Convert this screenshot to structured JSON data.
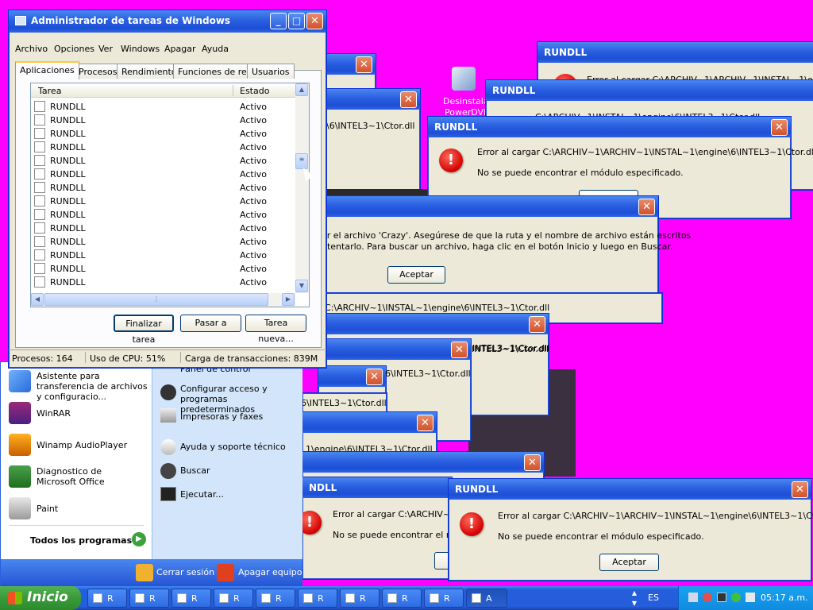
{
  "desktop": {
    "icon_label_1": "Desinstalar",
    "icon_label_2": "PowerDVD"
  },
  "dialogs": {
    "title": "RUNDLL",
    "close_glyph": "✕",
    "error_glyph": "!",
    "error_line_full": "Error al cargar C:\\ARCHIV~1\\ARCHIV~1\\INSTAL~1\\engine\\6\\INTEL3~1\\Ctor.dll",
    "error_line_cut": "Error al cargar C:\\ARCHIV~1\\ARCHIV~1\\INSTAL~1\\engine",
    "error_line_mid": "C:\\ARCHIV~1\\INSTAL~1\\engine\\6\\INTEL3~1\\Ctor.dll",
    "path_tail_a": "\\6\\INTEL3~1\\Ctor.dll",
    "path_tail_b": "INTEL3~1\\Ctor.dll",
    "path_tail_c": "6\\INTEL3~1\\Ctor.dll",
    "path_tail_d": "6\\INTEL3~1\\Ctor.dll",
    "path_tail_e": "1\\engine\\6\\INTEL3~1\\Ctor.dll",
    "module_line": "No se puede encontrar el módulo especificado.",
    "module_line_cut": "No se puede encontrar el módulo",
    "crazy_line_1": "ar el archivo 'Crazy'. Asegúrese de que la ruta y el nombre de archivo están escritos",
    "crazy_line_2": "ntentarlo. Para buscar un archivo, haga clic en el botón Inicio y luego en Buscar.",
    "ok_label": "Aceptar",
    "ndll_fragment": "NDLL"
  },
  "taskmgr": {
    "title": "Administrador de tareas de Windows",
    "menu": [
      "Archivo",
      "Opciones",
      "Ver",
      "Windows",
      "Apagar",
      "Ayuda"
    ],
    "tabs": [
      "Aplicaciones",
      "Procesos",
      "Rendimiento",
      "Funciones de red",
      "Usuarios"
    ],
    "columns": {
      "task": "Tarea",
      "status": "Estado"
    },
    "rows": [
      {
        "name": "RUNDLL",
        "status": "Activo"
      },
      {
        "name": "RUNDLL",
        "status": "Activo"
      },
      {
        "name": "RUNDLL",
        "status": "Activo"
      },
      {
        "name": "RUNDLL",
        "status": "Activo"
      },
      {
        "name": "RUNDLL",
        "status": "Activo"
      },
      {
        "name": "RUNDLL",
        "status": "Activo"
      },
      {
        "name": "RUNDLL",
        "status": "Activo"
      },
      {
        "name": "RUNDLL",
        "status": "Activo"
      },
      {
        "name": "RUNDLL",
        "status": "Activo"
      },
      {
        "name": "RUNDLL",
        "status": "Activo"
      },
      {
        "name": "RUNDLL",
        "status": "Activo"
      },
      {
        "name": "RUNDLL",
        "status": "Activo"
      },
      {
        "name": "RUNDLL",
        "status": "Activo"
      },
      {
        "name": "RUNDLL",
        "status": "Activo"
      }
    ],
    "buttons": {
      "end": "Finalizar tarea",
      "switch": "Pasar a",
      "new": "Tarea nueva..."
    },
    "status": {
      "processes": "Procesos: 164",
      "cpu": "Uso de CPU: 51%",
      "commit": "Carga de transacciones: 839M"
    }
  },
  "startmenu": {
    "left_items": [
      {
        "label": "Asistente para transferencia de archivos y configuracio..."
      },
      {
        "label": "WinRAR"
      },
      {
        "label": "Winamp AudioPlayer"
      },
      {
        "label": "Diagnostico de Microsoft Office"
      },
      {
        "label": "Paint"
      }
    ],
    "all_programs": "Todos los programas",
    "right_items": [
      {
        "label": "Panel de control"
      },
      {
        "label": "Configurar acceso y programas predeterminados"
      },
      {
        "label": "Impresoras y faxes"
      },
      {
        "label": "Ayuda y soporte técnico"
      },
      {
        "label": "Buscar"
      },
      {
        "label": "Ejecutar..."
      }
    ],
    "logoff": "Cerrar sesión",
    "shutdown": "Apagar equipo"
  },
  "taskbar": {
    "start_label": "Inicio",
    "buttons": [
      "R",
      "R",
      "R",
      "R",
      "R",
      "R",
      "R",
      "R",
      "R",
      "A"
    ],
    "language": "ES",
    "clock": "05:17 a.m."
  },
  "colors": {
    "desktop": "#ff00ff",
    "titlebar": "#2a5fe0",
    "taskbar": "#245edb",
    "start_button": "#3a9a3a"
  }
}
